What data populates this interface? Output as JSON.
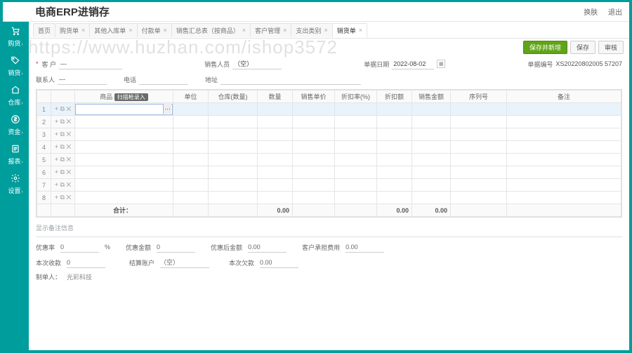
{
  "header": {
    "title": "电商ERP进销存",
    "links": [
      "换肤",
      "退出"
    ]
  },
  "watermark": "https://www.huzhan.com/ishop3572",
  "sidebar": {
    "items": [
      {
        "icon": "cart",
        "label": "购货"
      },
      {
        "icon": "tag",
        "label": "销货"
      },
      {
        "icon": "house",
        "label": "仓库"
      },
      {
        "icon": "dollar",
        "label": "资金"
      },
      {
        "icon": "doc",
        "label": "报表"
      },
      {
        "icon": "gear",
        "label": "设置"
      }
    ]
  },
  "tabs": {
    "items": [
      {
        "label": "首页",
        "closable": false
      },
      {
        "label": "购货单",
        "closable": true
      },
      {
        "label": "其他入库单",
        "closable": true
      },
      {
        "label": "付款单",
        "closable": true
      },
      {
        "label": "销售汇总表（按商品）",
        "closable": true
      },
      {
        "label": "客户管理",
        "closable": true
      },
      {
        "label": "支出类别",
        "closable": true
      },
      {
        "label": "销货单",
        "closable": true,
        "active": true
      }
    ]
  },
  "toolbar": {
    "save_new": "保存并新增",
    "save": "保存",
    "audit": "审核"
  },
  "form": {
    "customer_label": "客 户",
    "customer_value": "---",
    "salesperson_label": "销售人员",
    "salesperson_value": "（空）",
    "bill_date_label": "单据日期",
    "bill_date_value": "2022-08-02",
    "bill_no_label": "单据编号",
    "bill_no_value": "XS20220802005 57207",
    "linkman_label": "联系人",
    "linkman_value": "---",
    "phone_label": "电话",
    "address_label": "地址",
    "filter_label": "扫描枪录入"
  },
  "grid": {
    "columns": [
      "商品",
      "单位",
      "仓库(数量)",
      "数量",
      "销售单价",
      "折扣率(%)",
      "折扣额",
      "销售金额",
      "序列号",
      "备注"
    ],
    "row_count": 8,
    "row_ops": "+ ⧉ ✕",
    "totals_label": "合计：",
    "totals": {
      "qty": "0.00",
      "discount": "0.00",
      "amount": "0.00"
    }
  },
  "remark": {
    "label": "显示备注信息"
  },
  "bottom": {
    "discount_rate_label": "优惠率",
    "discount_rate": "0",
    "pct": "%",
    "discount_amt_label": "优惠金额",
    "discount_amt": "0",
    "after_amt_label": "优惠后金额",
    "after_amt": "0.00",
    "cust_fee_label": "客户承担费用",
    "cust_fee": "0.00",
    "this_recv_label": "本次收款",
    "this_recv": "0",
    "settle_acct_label": "结算账户",
    "settle_acct": "（空）",
    "this_owe_label": "本次欠款",
    "this_owe": "0.00",
    "maker_label": "制单人：",
    "maker": "光彩科技"
  }
}
